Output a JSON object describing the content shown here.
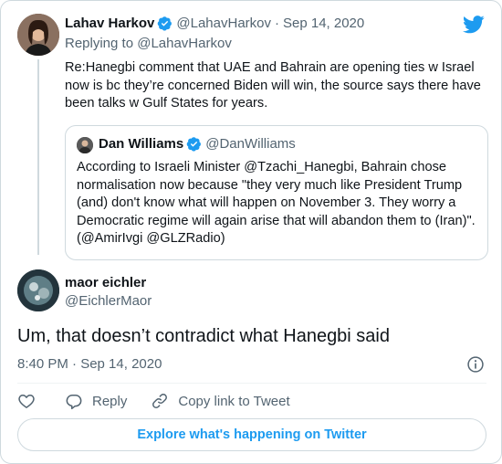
{
  "parent": {
    "name": "Lahav Harkov",
    "handle": "@LahavHarkov",
    "separator": "·",
    "date": "Sep 14, 2020",
    "replying_to": "Replying to @LahavHarkov",
    "text": "Re:Hanegbi comment that UAE and Bahrain are opening ties w Israel now is bc they’re concerned Biden will win, the source says there have been talks w Gulf States for years."
  },
  "quoted": {
    "name": "Dan Williams",
    "handle": "@DanWilliams",
    "text": "According to Israeli Minister @Tzachi_Hanegbi, Bahrain chose normalisation now because \"they very much like President Trump (and) don't know what will happen on November 3. They worry a Democratic regime will again arise that will abandon them to (Iran)\". (@AmirIvgi @GLZRadio)"
  },
  "tweet": {
    "name": "maor eichler",
    "handle": "@EichlerMaor",
    "text": "Um, that doesn’t contradict what Hanegbi said",
    "timestamp": "8:40 PM · Sep 14, 2020"
  },
  "actions": {
    "reply_label": "Reply",
    "copy_link_label": "Copy link to Tweet"
  },
  "explore_label": "Explore what's happening on Twitter",
  "colors": {
    "accent": "#1d9bf0",
    "muted": "#536471",
    "border": "#cfd9de"
  },
  "icons": [
    "twitter-bird-icon",
    "verified-badge-icon",
    "info-icon",
    "heart-icon",
    "reply-icon",
    "link-icon"
  ]
}
